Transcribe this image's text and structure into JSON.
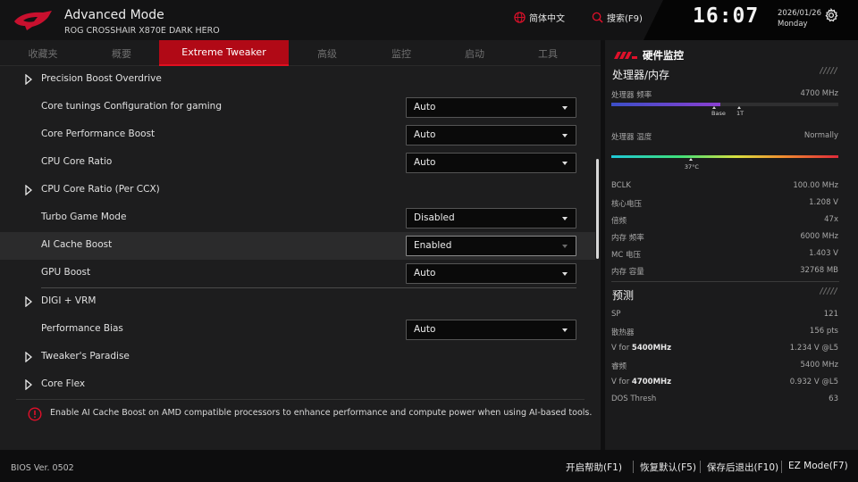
{
  "header": {
    "mode_title": "Advanced Mode",
    "board_name": "ROG CROSSHAIR X870E DARK HERO",
    "language": "简体中文",
    "search": "搜索(F9)",
    "clock": "16:07",
    "date": "2026/01/26",
    "weekday": "Monday"
  },
  "tabs": [
    {
      "label": "收藏夹",
      "active": false
    },
    {
      "label": "概要",
      "active": false
    },
    {
      "label": "Extreme Tweaker",
      "active": true
    },
    {
      "label": "高级",
      "active": false
    },
    {
      "label": "监控",
      "active": false
    },
    {
      "label": "启动",
      "active": false
    },
    {
      "label": "工具",
      "active": false
    }
  ],
  "rows": [
    {
      "label": "Precision Boost Overdrive",
      "expandable": true
    },
    {
      "label": "Core tunings Configuration for gaming",
      "value": "Auto"
    },
    {
      "label": "Core Performance Boost",
      "value": "Auto"
    },
    {
      "label": "CPU Core Ratio",
      "value": "Auto"
    },
    {
      "label": "CPU Core Ratio (Per CCX)",
      "expandable": true
    },
    {
      "label": "Turbo Game Mode",
      "value": "Disabled"
    },
    {
      "label": "AI Cache Boost",
      "value": "Enabled",
      "selected": true
    },
    {
      "label": "GPU Boost",
      "value": "Auto"
    },
    {
      "label": "DIGI + VRM",
      "expandable": true
    },
    {
      "label": "Performance Bias",
      "value": "Auto"
    },
    {
      "label": "Tweaker's Paradise",
      "expandable": true
    },
    {
      "label": "Core Flex",
      "expandable": true
    }
  ],
  "help_text": "Enable AI Cache Boost on AMD compatible processors to enhance performance and compute power when using AI-based tools.",
  "monitor": {
    "title": "硬件监控",
    "cpu_mem": {
      "title": "处理器/内存",
      "freq_label": "处理器 频率",
      "freq_value": "4700 MHz",
      "freq_fill": 0.48,
      "freq_markers": [
        "Base",
        "1T"
      ],
      "temp_label": "处理器 温度",
      "temp_value": "Normally",
      "temp_marker": "37°C",
      "temp_fraction": 0.35,
      "stats": [
        {
          "label": "BCLK",
          "value": "100.00 MHz"
        },
        {
          "label": "核心电压",
          "value": "1.208 V"
        },
        {
          "label": "倍频",
          "value": "47x"
        },
        {
          "label": "内存 频率",
          "value": "6000 MHz"
        },
        {
          "label": "MC 电压",
          "value": "1.403 V"
        },
        {
          "label": "内存 容量",
          "value": "32768 MB"
        }
      ]
    },
    "prediction": {
      "title": "预测",
      "stats": [
        {
          "label": "SP",
          "value": "121"
        },
        {
          "label": "散热器",
          "value": "156 pts"
        },
        {
          "label_prefix": "V for ",
          "label_bold": "5400MHz",
          "value": "1.234 V @L5"
        },
        {
          "label": "睿频",
          "value": "5400 MHz"
        },
        {
          "label_prefix": "V for ",
          "label_bold": "4700MHz",
          "value": "0.932 V @L5"
        },
        {
          "label": "DOS Thresh",
          "value": "63"
        }
      ]
    }
  },
  "footer": {
    "bios_version": "BIOS Ver. 0502",
    "buttons": [
      "开启帮助(F1)",
      "恢复默认(F5)",
      "保存后退出(F10)",
      "EZ Mode(F7)"
    ]
  },
  "colors": {
    "accent": "#b10916",
    "accent_bright": "#e01020",
    "freq_bar": "#6a3fc8"
  }
}
